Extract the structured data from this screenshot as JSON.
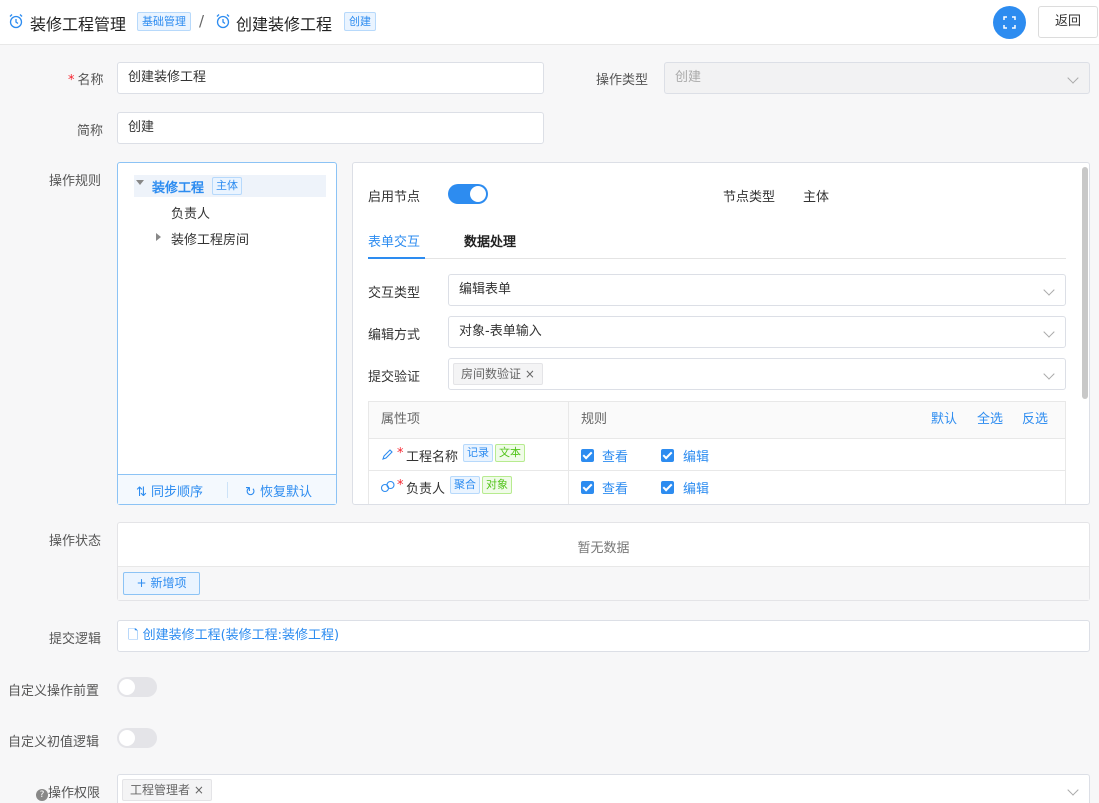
{
  "header": {
    "title": "装修工程管理",
    "title_tag": "基础管理",
    "separator": "/",
    "subtitle": "创建装修工程",
    "subtitle_tag": "创建",
    "back_label": "返回"
  },
  "form": {
    "name_label": "名称",
    "name_value": "创建装修工程",
    "op_type_label": "操作类型",
    "op_type_value": "创建",
    "short_label": "简称",
    "short_value": "创建",
    "rules_label": "操作规则",
    "status_label": "操作状态",
    "status_empty": "暂无数据",
    "add_item_label": "新增项",
    "submit_logic_label": "提交逻辑",
    "submit_logic_value": "创建装修工程(装修工程:装修工程)",
    "custom_pre_label": "自定义操作前置",
    "custom_init_label": "自定义初值逻辑",
    "permission_label": "操作权限",
    "permission_chip": "工程管理者"
  },
  "tree": {
    "root_label": "装修工程",
    "root_tag": "主体",
    "child1": "负责人",
    "child2": "装修工程房间",
    "sync_order": "同步顺序",
    "restore_default": "恢复默认"
  },
  "node": {
    "enable_label": "启用节点",
    "enabled": true,
    "node_type_label": "节点类型",
    "node_type_value": "主体",
    "tabs": [
      "表单交互",
      "数据处理"
    ],
    "active_tab": 0,
    "interaction_label": "交互类型",
    "interaction_value": "编辑表单",
    "edit_mode_label": "编辑方式",
    "edit_mode_value": "对象-表单输入",
    "validation_label": "提交验证",
    "validation_chip": "房间数验证"
  },
  "table": {
    "col_attr": "属性项",
    "col_rule": "规则",
    "action_default": "默认",
    "action_all": "全选",
    "action_invert": "反选",
    "rows": [
      {
        "name": "工程名称",
        "tag1": "记录",
        "tag2": "文本",
        "view": "查看",
        "edit": "编辑"
      },
      {
        "name": "负责人",
        "tag1": "聚合",
        "tag2": "对象",
        "view": "查看",
        "edit": "编辑"
      }
    ]
  },
  "colors": {
    "primary": "#2d8cf0",
    "required": "#f5222d",
    "tag_green": "#52c41a"
  }
}
